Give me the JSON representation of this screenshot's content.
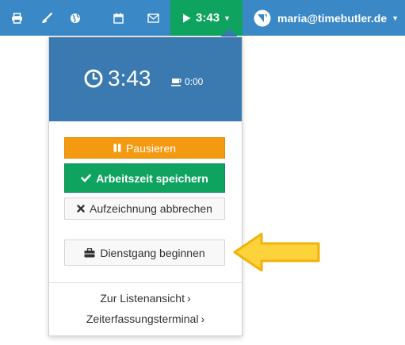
{
  "navbar": {
    "icons": [
      {
        "name": "printer-icon"
      },
      {
        "name": "brush-icon"
      },
      {
        "name": "globe-icon"
      },
      {
        "name": "calendar-icon"
      },
      {
        "name": "mail-icon"
      }
    ],
    "timer_label": "3:43",
    "user_email": "maria@timebutler.de",
    "colors": {
      "bar": "#3a88c5",
      "timer": "#0fa360"
    }
  },
  "dropdown": {
    "clock_time": "3:43",
    "break_time": "0:00",
    "pause_label": "Pausieren",
    "save_label": "Arbeitszeit speichern",
    "cancel_label": "Aufzeichnung abbrechen",
    "dienstgang_label": "Dienstgang beginnen",
    "list_view_label": "Zur Listenansicht",
    "terminal_label": "Zeiterfassungsterminal",
    "colors": {
      "header": "#3a7ab0",
      "pause": "#f49a10",
      "save": "#0fa360",
      "callout": "#fcd33a"
    }
  }
}
